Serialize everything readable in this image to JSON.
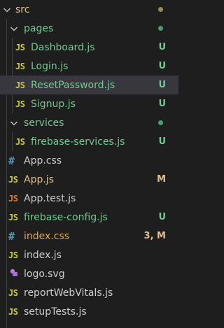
{
  "colors": {
    "untracked": "#73c991",
    "modified": "#e2c08d",
    "folder_text": "#73c991",
    "default_text": "#cccccc",
    "selected_bg": "#37373d",
    "dot_folder": "#4f9d6a",
    "dot_src": "#958a5c"
  },
  "tree": {
    "src": {
      "label": "src",
      "icon": "chevron-down-icon"
    },
    "pages": {
      "label": "pages",
      "icon": "chevron-down-icon"
    },
    "dashboard": {
      "label": "Dashboard.js",
      "type_icon": "JS",
      "status": "U"
    },
    "login": {
      "label": "Login.js",
      "type_icon": "JS",
      "status": "U"
    },
    "reset": {
      "label": "ResetPassword.js",
      "type_icon": "JS",
      "status": "U"
    },
    "signup": {
      "label": "Signup.js",
      "type_icon": "JS",
      "status": "U"
    },
    "services": {
      "label": "services",
      "icon": "chevron-down-icon"
    },
    "firebase_services": {
      "label": "firebase-services.js",
      "type_icon": "JS",
      "status": "U"
    },
    "app_css": {
      "label": "App.css",
      "type_icon": "#"
    },
    "app_js": {
      "label": "App.js",
      "type_icon": "JS",
      "status": "M"
    },
    "app_test": {
      "label": "App.test.js",
      "type_icon": "JS"
    },
    "firebase_config": {
      "label": "firebase-config.js",
      "type_icon": "JS",
      "status": "U"
    },
    "index_css": {
      "label": "index.css",
      "type_icon": "#",
      "status": "3, M"
    },
    "index_js": {
      "label": "index.js",
      "type_icon": "JS"
    },
    "logo": {
      "label": "logo.svg",
      "type_icon": "svg-icon"
    },
    "report": {
      "label": "reportWebVitals.js",
      "type_icon": "JS"
    },
    "setup": {
      "label": "setupTests.js",
      "type_icon": "JS"
    }
  }
}
